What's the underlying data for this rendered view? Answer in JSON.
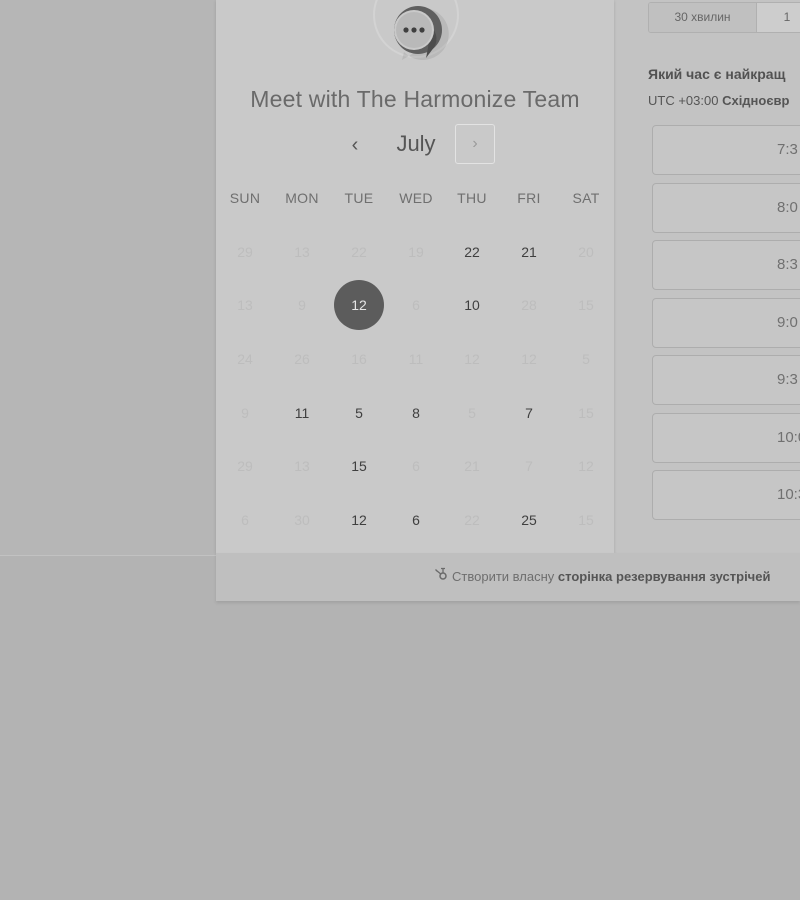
{
  "calendar": {
    "title": "Meet with The Harmonize Team",
    "month": "July",
    "prev_glyph": "‹",
    "next_glyph": "›",
    "weekdays": [
      "SUN",
      "MON",
      "TUE",
      "WED",
      "THU",
      "FRI",
      "SAT"
    ],
    "weeks": [
      [
        {
          "day": "29",
          "state": "muted"
        },
        {
          "day": "13",
          "state": "muted"
        },
        {
          "day": "22",
          "state": "muted"
        },
        {
          "day": "19",
          "state": "muted"
        },
        {
          "day": "22",
          "state": "active"
        },
        {
          "day": "21",
          "state": "active"
        },
        {
          "day": "20",
          "state": "muted"
        }
      ],
      [
        {
          "day": "13",
          "state": "muted"
        },
        {
          "day": "9",
          "state": "muted"
        },
        {
          "day": "12",
          "state": "selected"
        },
        {
          "day": "6",
          "state": "muted"
        },
        {
          "day": "10",
          "state": "active"
        },
        {
          "day": "28",
          "state": "muted"
        },
        {
          "day": "15",
          "state": "muted"
        }
      ],
      [
        {
          "day": "24",
          "state": "muted"
        },
        {
          "day": "26",
          "state": "muted"
        },
        {
          "day": "16",
          "state": "muted"
        },
        {
          "day": "11",
          "state": "muted"
        },
        {
          "day": "12",
          "state": "muted"
        },
        {
          "day": "12",
          "state": "muted"
        },
        {
          "day": "5",
          "state": "muted"
        }
      ],
      [
        {
          "day": "9",
          "state": "muted"
        },
        {
          "day": "11",
          "state": "active"
        },
        {
          "day": "5",
          "state": "active"
        },
        {
          "day": "8",
          "state": "active"
        },
        {
          "day": "5",
          "state": "muted"
        },
        {
          "day": "7",
          "state": "active"
        },
        {
          "day": "15",
          "state": "muted"
        }
      ],
      [
        {
          "day": "29",
          "state": "muted"
        },
        {
          "day": "13",
          "state": "muted"
        },
        {
          "day": "15",
          "state": "active"
        },
        {
          "day": "6",
          "state": "muted"
        },
        {
          "day": "21",
          "state": "muted"
        },
        {
          "day": "7",
          "state": "muted"
        },
        {
          "day": "12",
          "state": "muted"
        }
      ],
      [
        {
          "day": "6",
          "state": "muted"
        },
        {
          "day": "30",
          "state": "muted"
        },
        {
          "day": "12",
          "state": "active"
        },
        {
          "day": "6",
          "state": "active"
        },
        {
          "day": "22",
          "state": "muted"
        },
        {
          "day": "25",
          "state": "active"
        },
        {
          "day": "15",
          "state": "muted"
        }
      ]
    ]
  },
  "booking": {
    "durations": [
      "30 хвилин",
      "1"
    ],
    "question": "Який час є найкращ",
    "timezone_offset": "UTC +03:00",
    "timezone_name": "Східноєвр",
    "slots": [
      "7:3",
      "8:0",
      "8:3",
      "9:0",
      "9:3",
      "10:0",
      "10:3"
    ]
  },
  "footer": {
    "icon": "hubspot-sprocket-icon",
    "text_normal": "Створити власну",
    "text_bold": "сторінка резервування зустрічей"
  },
  "colors": {
    "selected_day": "#5c5c5c",
    "panel": "#c9c9c9",
    "backdrop": "#b3b3b3"
  }
}
